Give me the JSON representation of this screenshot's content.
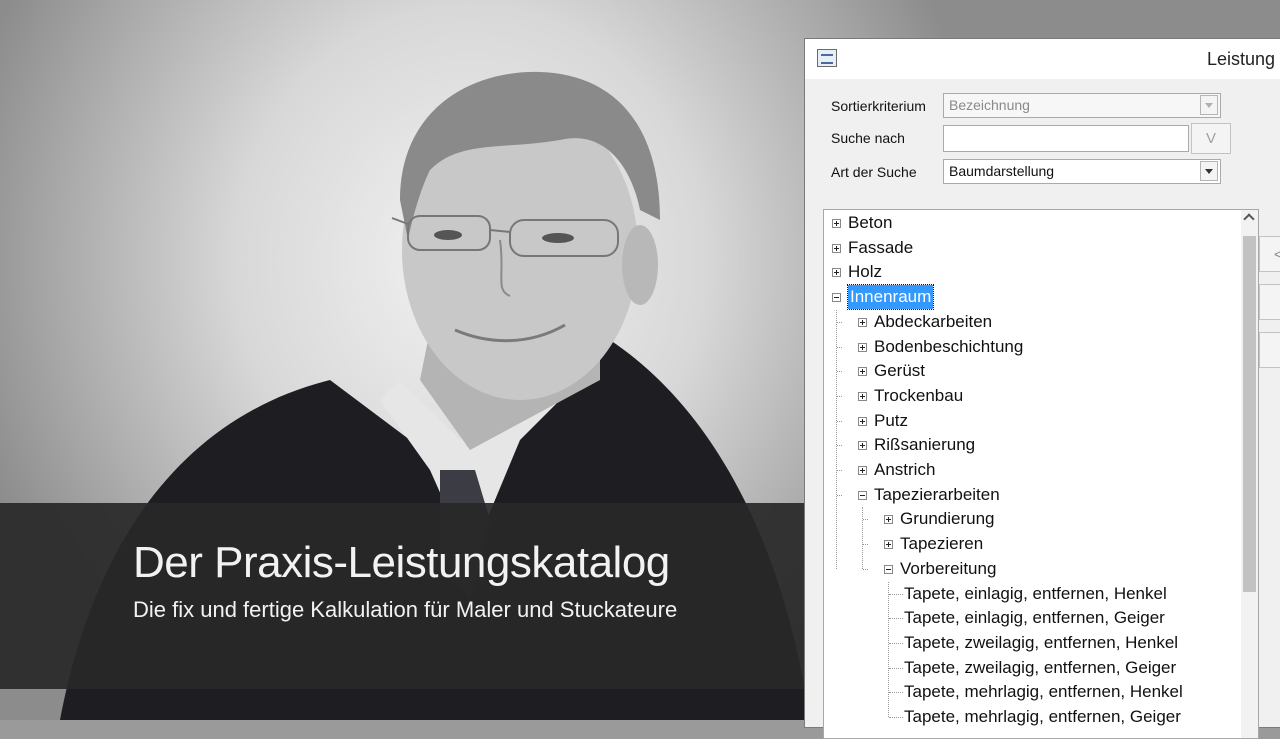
{
  "video": {
    "title": "Der Praxis-Leistungskatalog",
    "subtitle": "Die fix und fertige Kalkulation für Maler und Stuckateure"
  },
  "window": {
    "title": "Leistung",
    "icon": "app-window-icon"
  },
  "form": {
    "sort_label": "Sortierkriterium",
    "sort_value": "Bezeichnung",
    "search_label": "Suche nach",
    "search_value": "",
    "search_button": "V",
    "mode_label": "Art der Suche",
    "mode_value": "Baumdarstellung"
  },
  "tree": {
    "nodes": [
      {
        "label": "Beton",
        "level": 0,
        "toggle": "plus"
      },
      {
        "label": "Fassade",
        "level": 0,
        "toggle": "plus"
      },
      {
        "label": "Holz",
        "level": 0,
        "toggle": "plus"
      },
      {
        "label": "Innenraum",
        "level": 0,
        "toggle": "minus",
        "selected": true
      },
      {
        "label": "Abdeckarbeiten",
        "level": 1,
        "toggle": "plus"
      },
      {
        "label": "Bodenbeschichtung",
        "level": 1,
        "toggle": "plus"
      },
      {
        "label": "Gerüst",
        "level": 1,
        "toggle": "plus"
      },
      {
        "label": "Trockenbau",
        "level": 1,
        "toggle": "plus"
      },
      {
        "label": "Putz",
        "level": 1,
        "toggle": "plus"
      },
      {
        "label": "Rißsanierung",
        "level": 1,
        "toggle": "plus"
      },
      {
        "label": "Anstrich",
        "level": 1,
        "toggle": "plus"
      },
      {
        "label": "Tapezierarbeiten",
        "level": 1,
        "toggle": "minus"
      },
      {
        "label": "Grundierung",
        "level": 2,
        "toggle": "plus"
      },
      {
        "label": "Tapezieren",
        "level": 2,
        "toggle": "plus"
      },
      {
        "label": "Vorbereitung",
        "level": 2,
        "toggle": "minus"
      },
      {
        "label": "Tapete, einlagig, entfernen, Henkel",
        "level": 3,
        "toggle": "none"
      },
      {
        "label": "Tapete, einlagig, entfernen, Geiger",
        "level": 3,
        "toggle": "none"
      },
      {
        "label": "Tapete, zweilagig, entfernen, Henkel",
        "level": 3,
        "toggle": "none"
      },
      {
        "label": "Tapete, zweilagig, entfernen, Geiger",
        "level": 3,
        "toggle": "none"
      },
      {
        "label": "Tapete, mehrlagig, entfernen, Henkel",
        "level": 3,
        "toggle": "none"
      },
      {
        "label": "Tapete, mehrlagig, entfernen, Geiger",
        "level": 3,
        "toggle": "none"
      }
    ]
  },
  "side_buttons": [
    "<",
    "",
    ""
  ],
  "colors": {
    "selection": "#3399ff",
    "overlay": "#282828"
  }
}
